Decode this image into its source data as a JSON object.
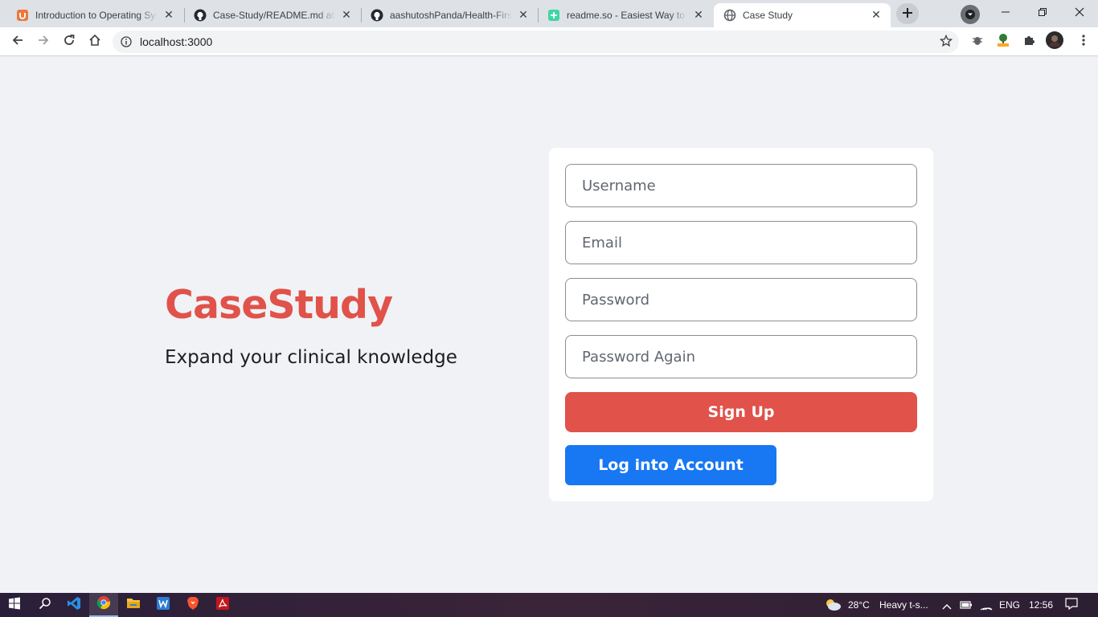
{
  "browser": {
    "tabs": [
      {
        "title": "Introduction to Operating Sys",
        "favicon": "udemy-icon"
      },
      {
        "title": "Case-Study/README.md at m",
        "favicon": "github-icon"
      },
      {
        "title": "aashutoshPanda/Health-First",
        "favicon": "github-icon"
      },
      {
        "title": "readme.so - Easiest Way to C",
        "favicon": "readme-icon"
      },
      {
        "title": "Case Study",
        "favicon": "globe-icon",
        "active": true
      }
    ],
    "address": "localhost:3000"
  },
  "page": {
    "brand": "CaseStudy",
    "tagline": "Expand your clinical knowledge",
    "form": {
      "username_placeholder": "Username",
      "email_placeholder": "Email",
      "password_placeholder": "Password",
      "password_again_placeholder": "Password Again",
      "signup_label": "Sign Up",
      "login_label": "Log into Account"
    }
  },
  "taskbar": {
    "weather": "28°C",
    "weather_desc": "Heavy t-s...",
    "language": "ENG",
    "time": "12:56"
  },
  "colors": {
    "brand": "#e0524a",
    "signup_button": "#e0524a",
    "login_button": "#1877f2",
    "page_background": "#f0f2f5"
  }
}
